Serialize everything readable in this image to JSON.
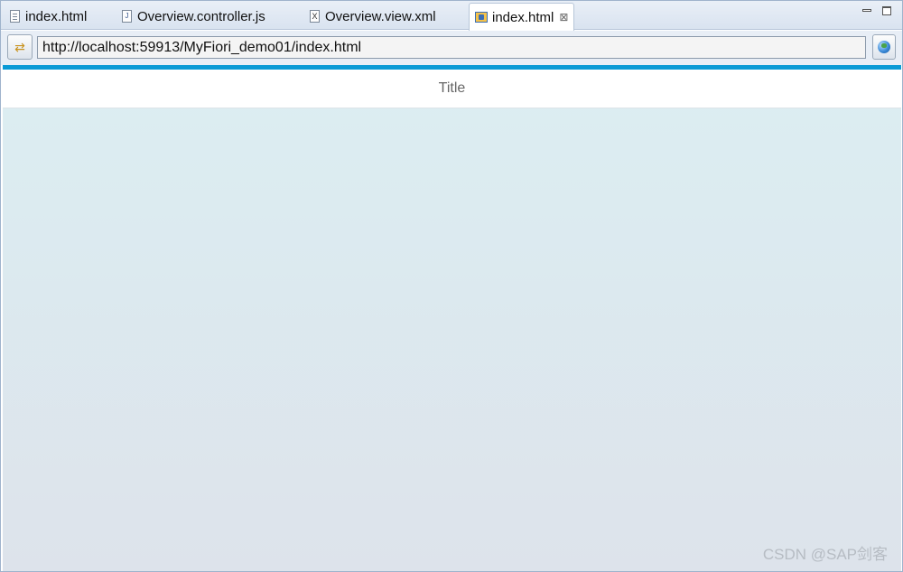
{
  "tabs": [
    {
      "label": "index.html",
      "icon": "html-file-icon",
      "active": false
    },
    {
      "label": "Overview.controller.js",
      "icon": "js-file-icon",
      "active": false
    },
    {
      "label": "Overview.view.xml",
      "icon": "xml-file-icon",
      "active": false
    },
    {
      "label": "index.html",
      "icon": "web-browser-icon",
      "active": true,
      "close": "⊠"
    }
  ],
  "address_bar": {
    "url": "http://localhost:59913/MyFiori_demo01/index.html"
  },
  "page": {
    "title": "Title",
    "accent_color": "#0a9ad6"
  },
  "watermark": "CSDN @SAP剑客"
}
